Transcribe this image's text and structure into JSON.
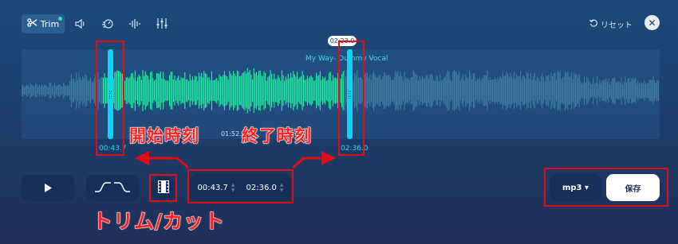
{
  "toolbar": {
    "trim_label": "Trim"
  },
  "header": {
    "reset_label": "リセット"
  },
  "track": {
    "title": "My Way- Dummy Vocal",
    "current_time": "02:23.0",
    "mid_time": "01:52.2"
  },
  "selection": {
    "start": "00:43.7",
    "end": "02:36.0",
    "start_fraction": 0.127,
    "end_fraction": 0.506
  },
  "annotations": {
    "start_label": "開始時刻",
    "end_label": "終了時刻",
    "trim_label": "トリム/カット"
  },
  "controls": {
    "start_value": "00:43.7",
    "end_value": "02:36.0",
    "format": "mp3 ▾",
    "save_label": "保存"
  },
  "colors": {
    "accent": "#0fd3f0",
    "selected_wave": "#1ff5a0",
    "unselected_wave": "#3f7fa3",
    "annotation_red": "#e10d14"
  },
  "icons": [
    "scissors-icon",
    "volume-icon",
    "speed-icon",
    "equalizer-icon",
    "mixer-icon",
    "reset-icon",
    "close-icon",
    "play-icon",
    "fade-in-icon",
    "fade-out-icon",
    "trim-cut-icon"
  ]
}
